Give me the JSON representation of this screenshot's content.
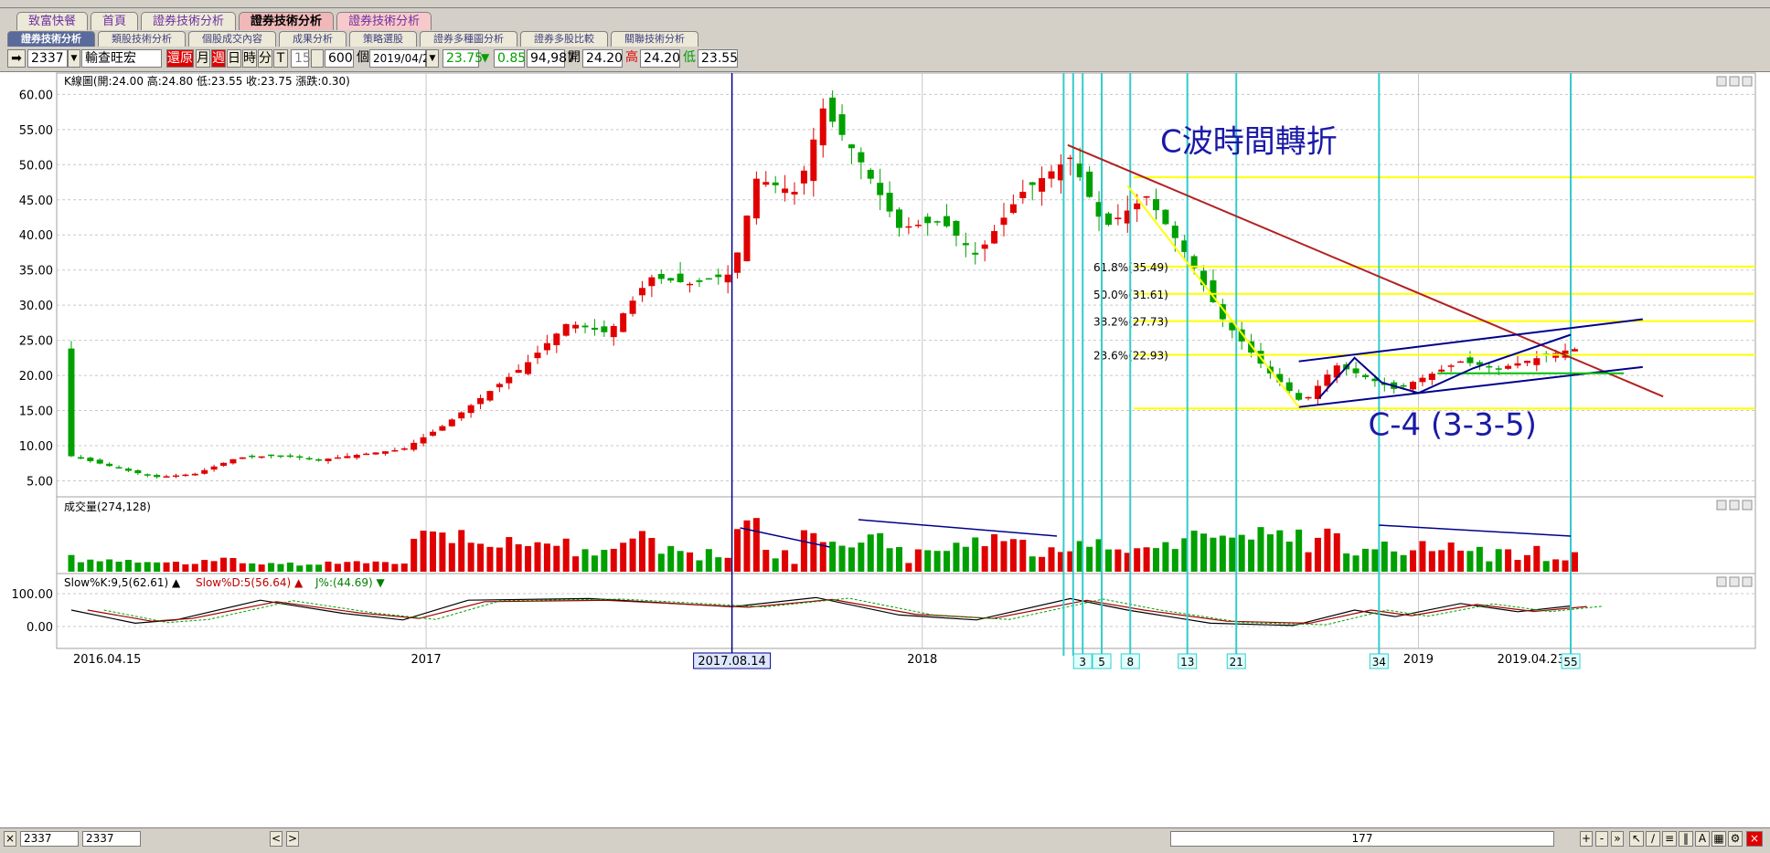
{
  "tabs_row1": [
    {
      "label": "致富快餐",
      "state": "normal"
    },
    {
      "label": "首頁",
      "state": "normal"
    },
    {
      "label": "證券技術分析",
      "state": "normal"
    },
    {
      "label": "證券技術分析",
      "state": "active"
    },
    {
      "label": "證券技術分析",
      "state": "pink"
    }
  ],
  "tabs_row2": [
    {
      "label": "證券技術分析",
      "state": "active"
    },
    {
      "label": "類股技術分析",
      "state": "normal"
    },
    {
      "label": "個股成交內容",
      "state": "normal"
    },
    {
      "label": "成果分析",
      "state": "normal"
    },
    {
      "label": "策略選股",
      "state": "normal"
    },
    {
      "label": "證券多種圖分析",
      "state": "normal"
    },
    {
      "label": "證券多股比較",
      "state": "normal"
    },
    {
      "label": "關聯技術分析",
      "state": "normal"
    }
  ],
  "toolbar": {
    "code": "2337",
    "name": "輸查旺宏",
    "restore_label": "還原",
    "periods": [
      "月",
      "週",
      "日",
      "時",
      "分"
    ],
    "t_label": "T",
    "interval": "15",
    "count": "600",
    "count_unit": "個",
    "date": "2019/04/23",
    "price": "23.75",
    "change": "0.85",
    "volume": "94,987",
    "open_label": "開",
    "open": "24.20",
    "high_label": "高",
    "high": "24.20",
    "low_label": "低",
    "low": "23.55"
  },
  "status": {
    "code1": "2337",
    "code2": "2337",
    "scroll_value": "177"
  },
  "colors": {
    "up": "#e00000",
    "down": "#00a000",
    "trend": "#b22222",
    "channel": "#00008b",
    "fib": "#ffff00",
    "cyan": "#33cccc",
    "ma": "#ffff00"
  },
  "chart_data": {
    "type": "candlestick",
    "panels": {
      "price": {
        "header": "K線圖(開:24.00 高:24.80 低:23.55 收:23.75 漲跌:0.30)",
        "ylim": [
          3.5,
          62
        ],
        "ticks": [
          5,
          10,
          15,
          20,
          25,
          30,
          35,
          40,
          45,
          50,
          55,
          60
        ],
        "tick_labels": [
          "5.00",
          "10.00",
          "15.00",
          "20.00",
          "25.00",
          "30.00",
          "35.00",
          "40.00",
          "45.00",
          "50.00",
          "55.00",
          "60.00"
        ]
      },
      "volume": {
        "header": "成交量(274,128)"
      },
      "kd": {
        "header_k": "Slow%K:9,5(62.61)",
        "header_d": "Slow%D:5(56.64)",
        "header_j": "J%:(44.69)",
        "ticks": [
          0,
          100
        ],
        "tick_labels": [
          "0.00",
          "100.00"
        ]
      }
    },
    "x_range": [
      "2016-04-15",
      "2019-04-23"
    ],
    "x_labels": [
      {
        "date": "2016-04-15",
        "label": "2016.04.15"
      },
      {
        "date": "2017-01-01",
        "label": "2017"
      },
      {
        "date": "2018-01-01",
        "label": "2018"
      },
      {
        "date": "2019-01-01",
        "label": "2019"
      },
      {
        "date": "2019-04-23",
        "label": "2019.04.23"
      }
    ],
    "marker_date": {
      "date": "2017-08-14",
      "label": "2017.08.14"
    },
    "price_trend_points": [
      [
        "2016-04-15",
        8.5
      ],
      [
        "2016-05-15",
        7.0
      ],
      [
        "2016-06-15",
        5.5
      ],
      [
        "2016-07-15",
        6.0
      ],
      [
        "2016-08-15",
        8.3
      ],
      [
        "2016-09-15",
        8.6
      ],
      [
        "2016-10-15",
        8.0
      ],
      [
        "2016-11-15",
        8.8
      ],
      [
        "2016-12-15",
        9.5
      ],
      [
        "2017-01-15",
        13.0
      ],
      [
        "2017-02-15",
        17.5
      ],
      [
        "2017-03-15",
        21.5
      ],
      [
        "2017-04-15",
        27.5
      ],
      [
        "2017-05-15",
        26.0
      ],
      [
        "2017-06-15",
        34.0
      ],
      [
        "2017-07-15",
        33.0
      ],
      [
        "2017-08-14",
        34.5
      ],
      [
        "2017-09-01",
        48.0
      ],
      [
        "2017-10-01",
        46.0
      ],
      [
        "2017-10-20",
        58.0
      ],
      [
        "2017-11-15",
        51.0
      ],
      [
        "2017-12-15",
        41.0
      ],
      [
        "2018-01-15",
        42.0
      ],
      [
        "2018-02-10",
        37.0
      ],
      [
        "2018-03-15",
        46.0
      ],
      [
        "2018-04-20",
        51.0
      ],
      [
        "2018-05-15",
        41.0
      ],
      [
        "2018-06-15",
        45.5
      ],
      [
        "2018-07-15",
        37.0
      ],
      [
        "2018-08-10",
        28.0
      ],
      [
        "2018-09-10",
        21.0
      ],
      [
        "2018-10-08",
        16.0
      ],
      [
        "2018-11-01",
        21.5
      ],
      [
        "2018-12-15",
        18.0
      ],
      [
        "2019-02-01",
        22.0
      ],
      [
        "2019-03-01",
        21.0
      ],
      [
        "2019-04-23",
        23.75
      ]
    ],
    "kd_k": [
      [
        "2016-04-15",
        50
      ],
      [
        "2016-06-01",
        10
      ],
      [
        "2016-07-01",
        20
      ],
      [
        "2016-09-01",
        80
      ],
      [
        "2016-11-01",
        40
      ],
      [
        "2016-12-15",
        20
      ],
      [
        "2017-02-01",
        80
      ],
      [
        "2017-05-01",
        85
      ],
      [
        "2017-08-14",
        60
      ],
      [
        "2017-10-15",
        88
      ],
      [
        "2017-12-15",
        35
      ],
      [
        "2018-02-10",
        20
      ],
      [
        "2018-04-20",
        85
      ],
      [
        "2018-06-01",
        50
      ],
      [
        "2018-08-01",
        10
      ],
      [
        "2018-10-01",
        3
      ],
      [
        "2018-11-15",
        50
      ],
      [
        "2018-12-15",
        30
      ],
      [
        "2019-02-01",
        70
      ],
      [
        "2019-03-15",
        45
      ],
      [
        "2019-04-23",
        62.61
      ]
    ],
    "fibonacci": [
      {
        "label": "61.8%(35.49)",
        "value": 35.49
      },
      {
        "label": "50.0%(31.61)",
        "value": 31.61
      },
      {
        "label": "38.2%(27.73)",
        "value": 27.73
      },
      {
        "label": "23.6%(22.93)",
        "value": 22.93
      }
    ],
    "horizontal_levels": [
      48.2,
      35.49,
      31.61,
      27.73,
      22.93,
      15.3
    ],
    "time_lines": [
      {
        "date": "2018-04-15",
        "label": ""
      },
      {
        "date": "2018-04-22",
        "label": ""
      },
      {
        "date": "2018-04-29",
        "label": "3"
      },
      {
        "date": "2018-05-13",
        "label": "5"
      },
      {
        "date": "2018-06-03",
        "label": "8"
      },
      {
        "date": "2018-07-15",
        "label": "13"
      },
      {
        "date": "2018-08-20",
        "label": "21"
      },
      {
        "date": "2018-12-03",
        "label": "34"
      },
      {
        "date": "2019-04-23",
        "label": "55"
      }
    ],
    "annotations": [
      {
        "text": "C波時間轉折",
        "date": "2018-06-25",
        "value": 51.8
      },
      {
        "text": "C-4 (3-3-5)",
        "date": "2018-11-25",
        "value": 11.5
      }
    ],
    "trendline": [
      [
        "2018-04-18",
        52.8
      ],
      [
        "2019-06-30",
        17.0
      ]
    ],
    "channel_upper": [
      [
        "2018-10-05",
        22.0
      ],
      [
        "2019-06-15",
        28.0
      ]
    ],
    "channel_lower": [
      [
        "2018-10-05",
        15.5
      ],
      [
        "2019-06-15",
        21.2
      ]
    ]
  }
}
